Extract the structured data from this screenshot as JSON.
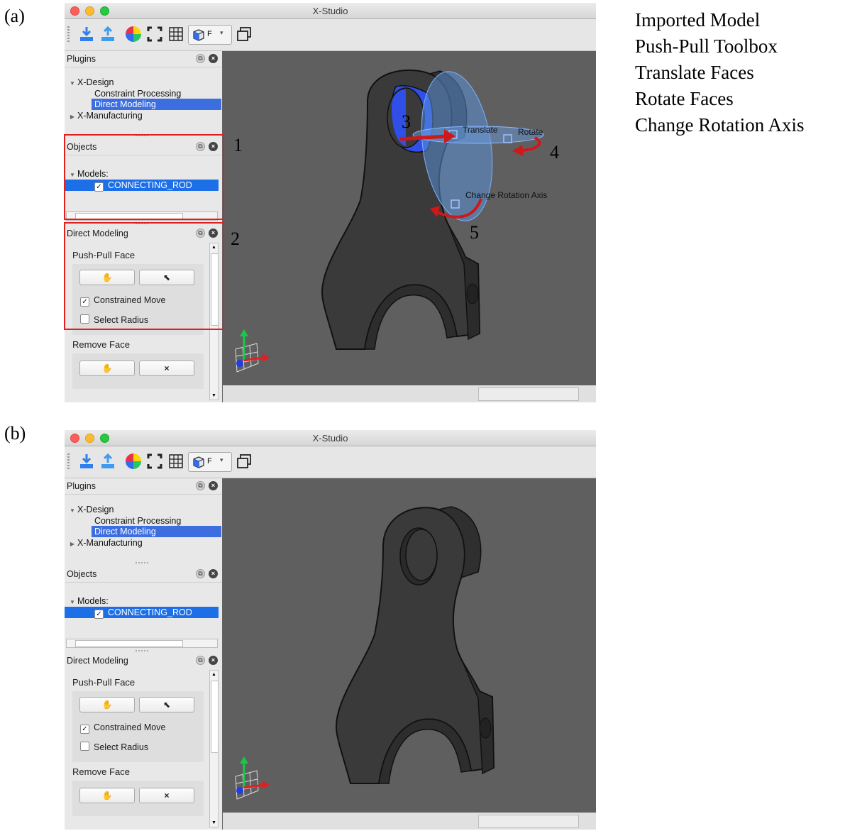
{
  "figure": {
    "panel_a": "(a)",
    "panel_b": "(b)",
    "legend": [
      "Imported Model",
      "Push-Pull Toolbox",
      "Translate Faces",
      "Rotate Faces",
      "Change Rotation Axis"
    ],
    "callouts": [
      "1",
      "2",
      "3",
      "4",
      "5"
    ]
  },
  "app": {
    "title": "X-Studio",
    "toolbar": {
      "icons": [
        "import-icon",
        "export-icon",
        "color-wheel-icon",
        "fit-view-icon",
        "grid-icon",
        "view-cube-icon",
        "window-icon"
      ],
      "view_dropdown_value": "F"
    },
    "plugins": {
      "title": "Plugins",
      "tree": {
        "x_design": "X-Design",
        "constraint_processing": "Constraint Processing",
        "direct_modeling": "Direct Modeling",
        "x_manufacturing": "X-Manufacturing"
      }
    },
    "objects": {
      "title": "Objects",
      "models_label": "Models:",
      "model_name": "CONNECTING_ROD",
      "model_checked": true
    },
    "direct_modeling": {
      "title": "Direct Modeling",
      "push_pull_label": "Push-Pull Face",
      "constrained_move": "Constrained Move",
      "constrained_move_checked": true,
      "select_radius": "Select Radius",
      "select_radius_checked": false,
      "remove_face_label": "Remove Face",
      "remove_glyph": "×"
    },
    "viewport": {
      "manipulator_labels": {
        "translate": "Translate",
        "rotate": "Rotate",
        "change_axis": "Change Rotation Axis"
      }
    },
    "colors": {
      "accent_selection": "#3d6ee0",
      "highlight_face": "#2f4fe6",
      "annotation_red": "#e02020",
      "viewport_bg": "#5f5f5f",
      "model_fill": "#3a3a3a"
    }
  }
}
